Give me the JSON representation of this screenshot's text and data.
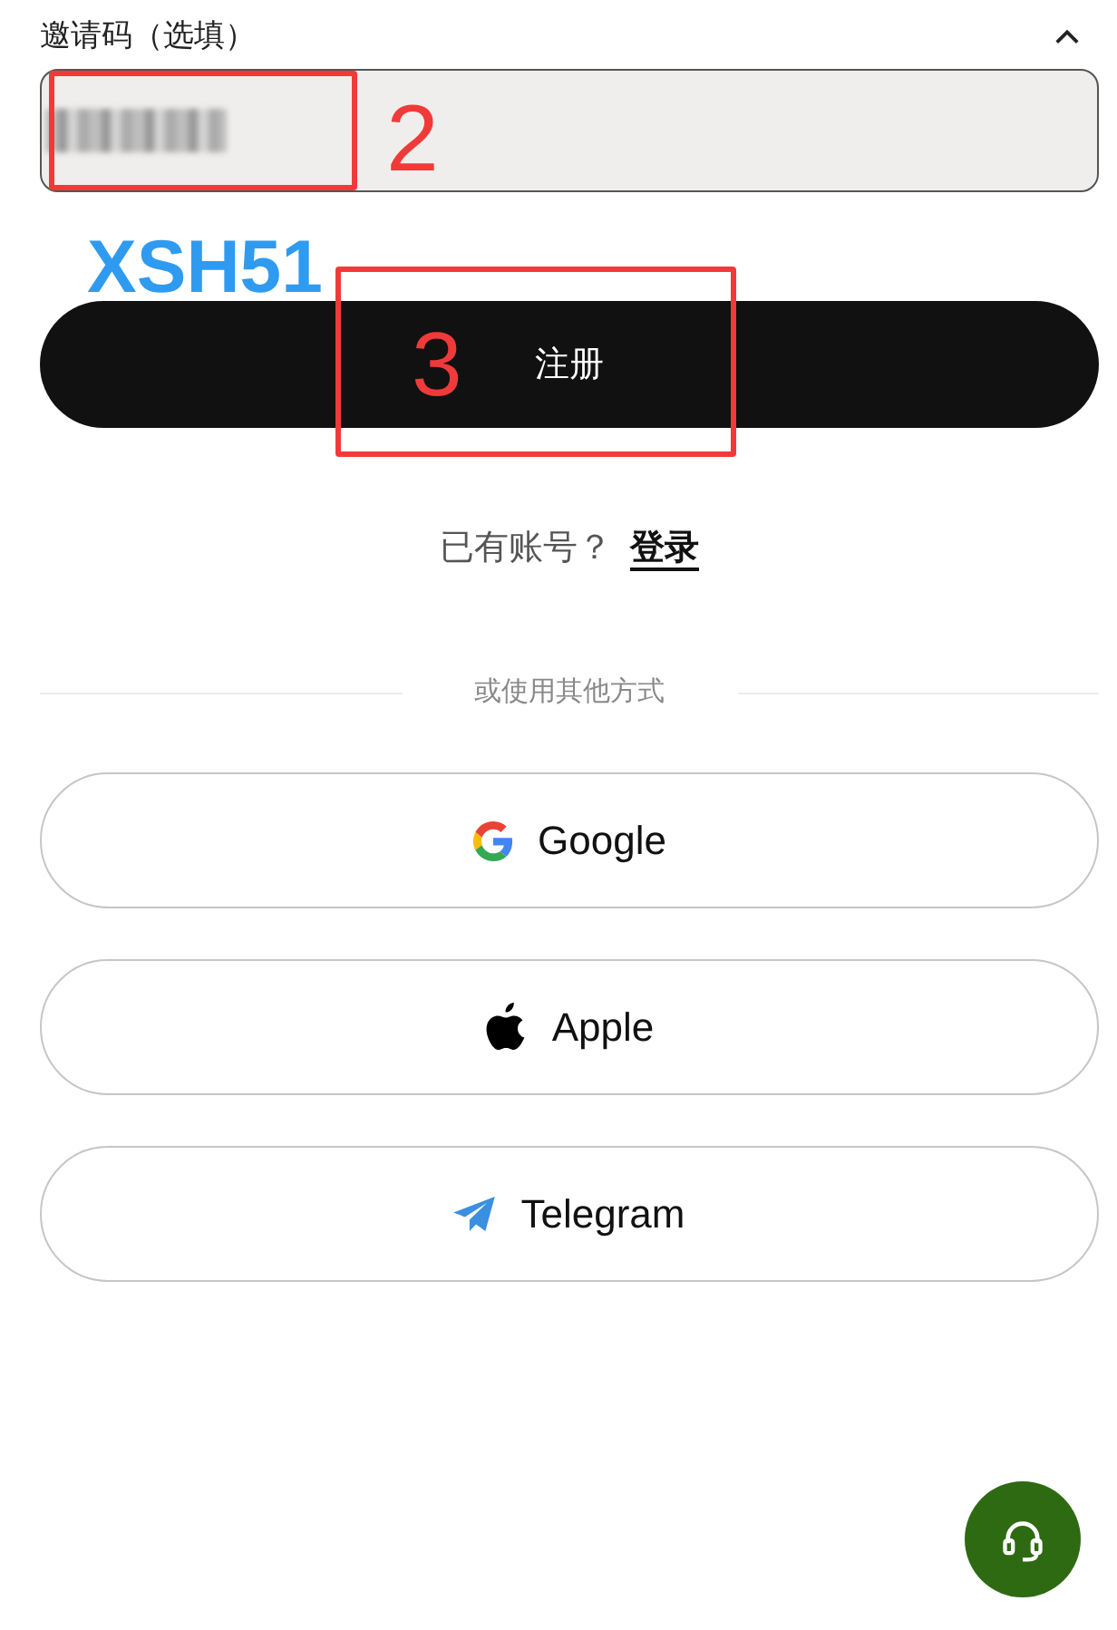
{
  "invite_code": {
    "label": "邀请码（选填）",
    "expanded": true,
    "value_blurred": true,
    "annotation_number": "2"
  },
  "note": "XSH51",
  "register_button": {
    "label": "注册",
    "annotation_number": "3"
  },
  "login_prompt": {
    "text": "已有账号？",
    "link": "登录"
  },
  "divider_text": "或使用其他方式",
  "social_buttons": [
    {
      "kind": "google",
      "label": "Google"
    },
    {
      "kind": "apple",
      "label": "Apple"
    },
    {
      "kind": "telegram",
      "label": "Telegram"
    }
  ]
}
